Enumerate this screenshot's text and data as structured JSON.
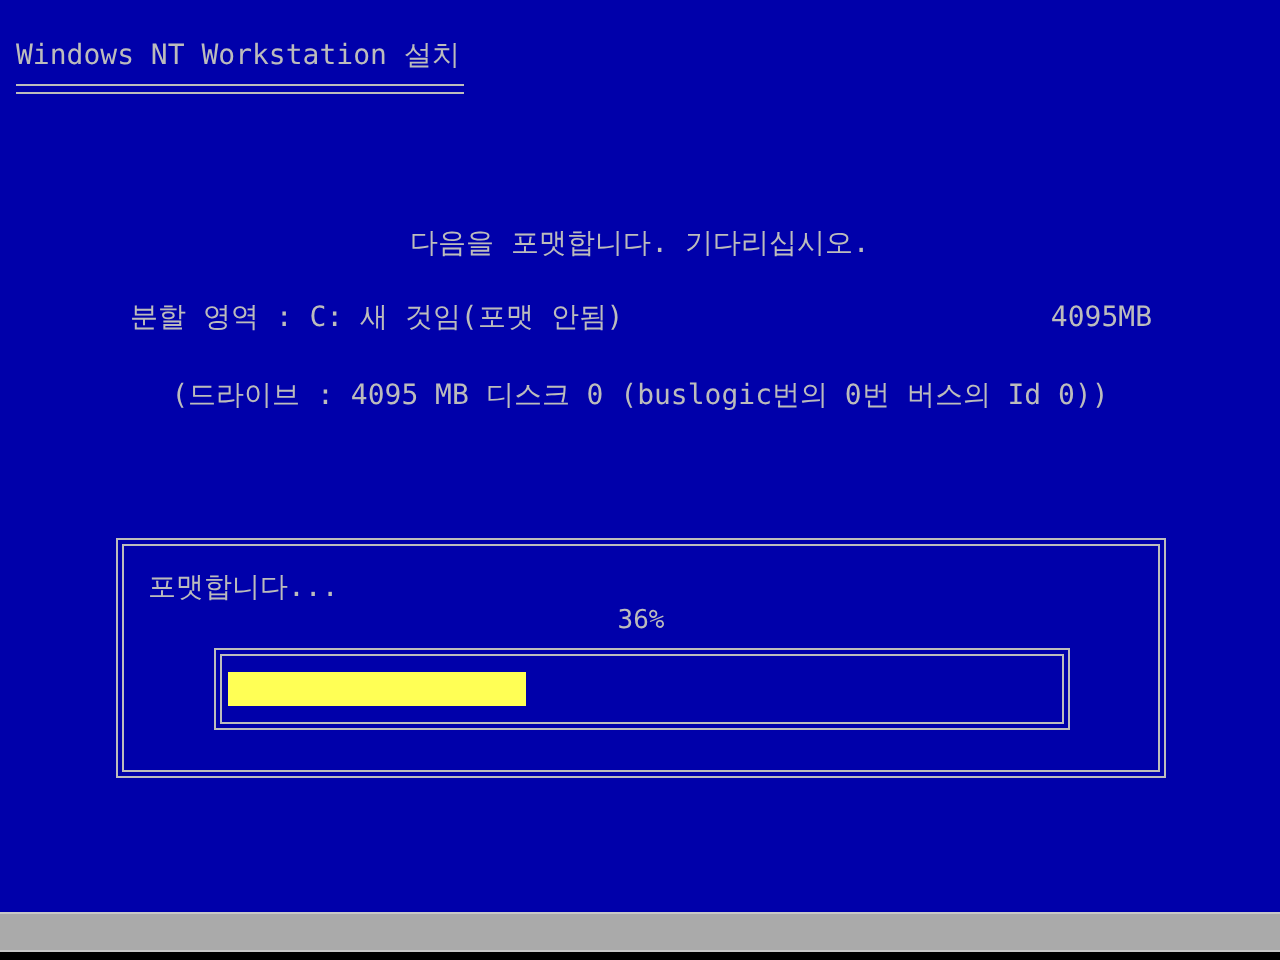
{
  "header": {
    "title": "Windows NT Workstation 설치"
  },
  "message": "다음을 포맷합니다. 기다리십시오.",
  "partition": {
    "label": "분할 영역 : C: 새 것임(포맷 안됨)",
    "size": "4095MB"
  },
  "drive": "(드라이브 : 4095 MB 디스크 0 (buslogic번의 0번 버스의 Id 0))",
  "progress_dialog": {
    "caption": "포맷합니다...",
    "percent": "36%",
    "level": 0.36
  }
}
